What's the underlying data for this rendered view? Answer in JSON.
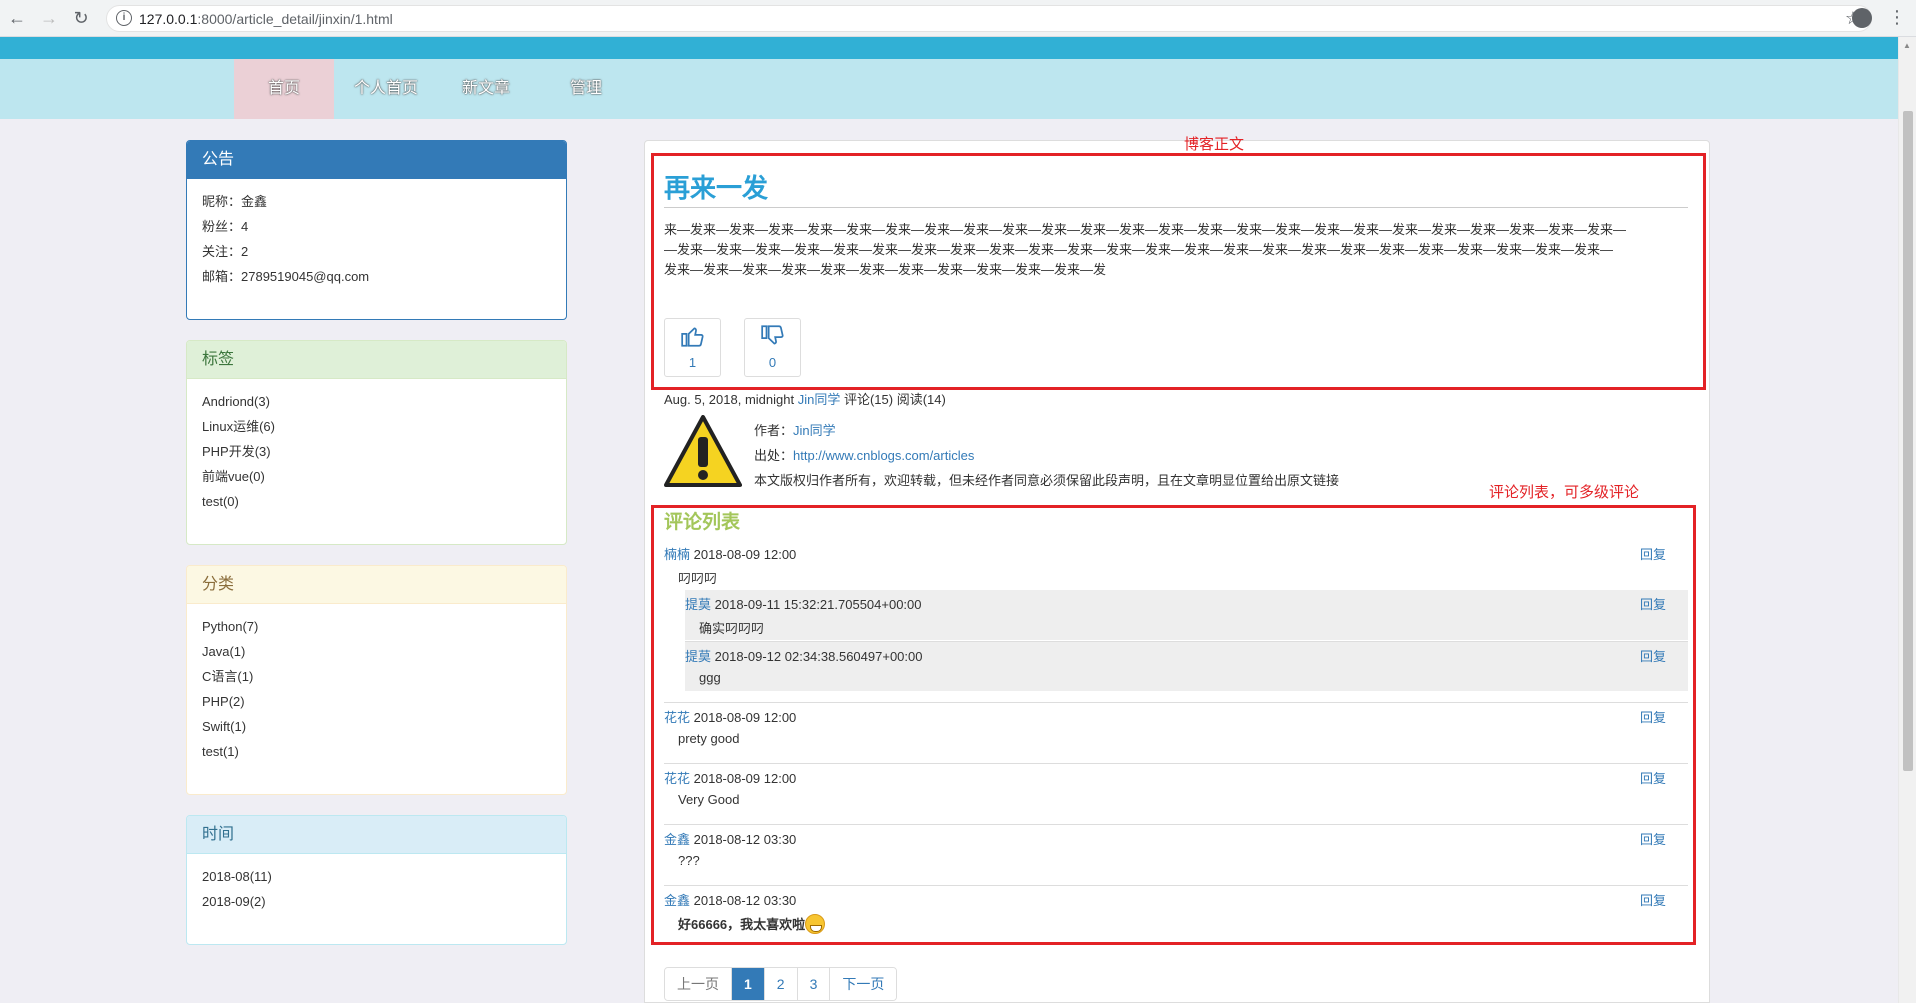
{
  "browser": {
    "url_host": "127.0.0.1",
    "url_rest": ":8000/article_detail/jinxin/1.html"
  },
  "nav": {
    "items": [
      "首页",
      "个人首页",
      "新文章",
      "管理"
    ]
  },
  "sidebar": {
    "notice": {
      "title": "公告",
      "lines": [
        "昵称：金鑫",
        "粉丝：4",
        "关注：2",
        "邮箱：2789519045@qq.com"
      ]
    },
    "tags": {
      "title": "标签",
      "items": [
        "Andriond(3)",
        "Linux运维(6)",
        "PHP开发(3)",
        "前端vue(0)",
        "test(0)"
      ]
    },
    "categories": {
      "title": "分类",
      "items": [
        "Python(7)",
        "Java(1)",
        "C语言(1)",
        "PHP(2)",
        "Swift(1)",
        "test(1)"
      ]
    },
    "archive": {
      "title": "时间",
      "items": [
        "2018-08(11)",
        "2018-09(2)"
      ]
    }
  },
  "annotations": {
    "article": "博客正文",
    "comments": "评论列表，可多级评论"
  },
  "article": {
    "title": "再来一发",
    "body_lines": [
      "来—发来—发来—发来—发来—发来—发来—发来—发来—发来—发来—发来—发来—发来—发来—发来—发来—发来—发来—发来—发来—发来—发来—发来—发来—",
      "—发来—发来—发来—发来—发来—发来—发来—发来—发来—发来—发来—发来—发来—发来—发来—发来—发来—发来—发来—发来—发来—发来—发来—发来—",
      "发来—发来—发来—发来—发来—发来—发来—发来—发来—发来—发来—发"
    ],
    "like_count": "1",
    "dislike_count": "0",
    "meta_date": "Aug. 5, 2018, midnight",
    "meta_author": "Jin同学",
    "meta_stats": "评论(15) 阅读(14)",
    "copyright": {
      "author_label": "作者：",
      "author": "Jin同学",
      "source_label": "出处：",
      "source": "http://www.cnblogs.com/articles",
      "notice": "本文版权归作者所有，欢迎转载，但未经作者同意必须保留此段声明，且在文章明显位置给出原文链接"
    }
  },
  "comments": {
    "title": "评论列表",
    "reply_label": "回复",
    "items": [
      {
        "user": "楠楠",
        "time": "2018-08-09 12:00",
        "text": "叼叼叼"
      },
      {
        "user": "提莫",
        "time": "2018-09-11 15:32:21.705504+00:00",
        "text": "确实叼叼叼"
      },
      {
        "user": "提莫",
        "time": "2018-09-12 02:34:38.560497+00:00",
        "text": "ggg"
      },
      {
        "user": "花花",
        "time": "2018-08-09 12:00",
        "text": "prety good"
      },
      {
        "user": "花花",
        "time": "2018-08-09 12:00",
        "text": "Very Good"
      },
      {
        "user": "金鑫",
        "time": "2018-08-12 03:30",
        "text": "???"
      },
      {
        "user": "金鑫",
        "time": "2018-08-12 03:30",
        "text": "好66666，我太喜欢啦"
      }
    ]
  },
  "pagination": {
    "prev": "上一页",
    "pages": [
      "1",
      "2",
      "3"
    ],
    "next": "下一页"
  }
}
